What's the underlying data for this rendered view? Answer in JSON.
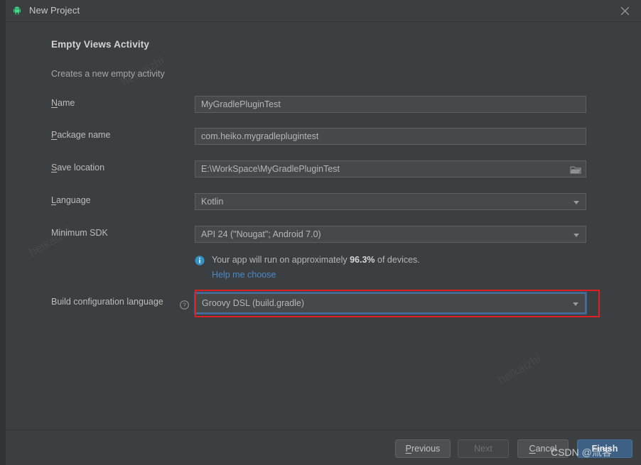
{
  "window": {
    "title": "New Project",
    "icon": "android-robot-icon",
    "close_label": "✕"
  },
  "wizard": {
    "heading": "Empty Views Activity",
    "subheading": "Creates a new empty activity"
  },
  "form": {
    "rows": [
      {
        "label": "Name",
        "mnemonic": "N",
        "label_rest": "ame",
        "type": "text",
        "value": "MyGradlePluginTest",
        "name": "name"
      },
      {
        "label": "Package name",
        "mnemonic": "P",
        "label_rest": "ackage name",
        "type": "text",
        "value": "com.heiko.mygradleplugintest",
        "name": "package-name"
      },
      {
        "label": "Save location",
        "mnemonic": "S",
        "label_rest": "ave location",
        "type": "text-browse",
        "value": "E:\\WorkSpace\\MyGradlePluginTest",
        "browse_icon": "folder-icon",
        "name": "save-location"
      },
      {
        "label": "Language",
        "mnemonic": "L",
        "label_rest": "anguage",
        "type": "combo",
        "value": "Kotlin",
        "name": "language"
      },
      {
        "label": "Minimum SDK",
        "mnemonic": "",
        "label_rest": "Minimum SDK",
        "type": "combo",
        "value": "API 24 (\"Nougat\"; Android 7.0)",
        "name": "minimum-sdk"
      },
      {
        "label": "Build configuration language",
        "mnemonic": "",
        "label_rest": "Build configuration language",
        "type": "combo-focused",
        "value": "Groovy DSL (build.gradle)",
        "help_icon": "question-mark-icon",
        "name": "build-configuration-language"
      }
    ]
  },
  "info": {
    "icon": "info-icon",
    "text_before": "Your app will run on approximately ",
    "percent": "96.3%",
    "text_after": " of devices.",
    "link": "Help me choose"
  },
  "footer": {
    "buttons": [
      {
        "label": "Previous",
        "mnemonic": "P",
        "rest": "revious",
        "state": "enabled",
        "name": "previous-button"
      },
      {
        "label": "Next",
        "mnemonic": "",
        "rest": "Next",
        "state": "disabled",
        "name": "next-button"
      },
      {
        "label": "Cancel",
        "mnemonic": "C",
        "rest": "ancel",
        "state": "enabled",
        "name": "cancel-button"
      },
      {
        "label": "Finish",
        "mnemonic": "",
        "rest": "Finish",
        "state": "default",
        "name": "finish-button"
      }
    ]
  },
  "watermarks": {
    "csdn": "CSDN @氚客",
    "faint": "heikaizhi"
  },
  "colors": {
    "window_bg": "#3c3f41",
    "field_bg": "#45494a",
    "accent_blue": "#4a88c7",
    "default_button": "#3d6185",
    "annotation_red": "#e02020",
    "android_green": "#3ddc84"
  }
}
